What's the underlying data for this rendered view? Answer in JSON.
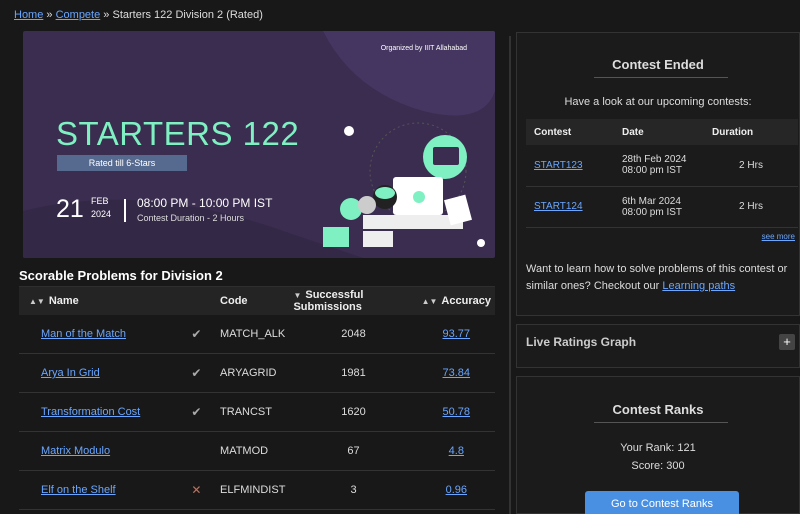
{
  "breadcrumb": {
    "home": "Home",
    "sep1": "»",
    "compete": "Compete",
    "sep2": "»",
    "current": "Starters 122 Division 2 (Rated)"
  },
  "banner": {
    "organizer": "Organized by IIIT Allahabad",
    "title": "STARTERS 122",
    "rated": "Rated till 6-Stars",
    "day": "21",
    "month": "FEB",
    "year": "2024",
    "time": "08:00 PM - 10:00 PM IST",
    "duration": "Contest Duration - 2  Hours",
    "colors": {
      "bg": "#3a2d4f",
      "title": "#7ff0c2",
      "badge": "#566a8f"
    }
  },
  "problems": {
    "title": "Scorable Problems for Division 2",
    "headers": {
      "name": "Name",
      "code": "Code",
      "subs": "Successful Submissions",
      "acc": "Accuracy"
    },
    "rows": [
      {
        "name": "Man of the Match",
        "status": "solved",
        "mark": "✔",
        "code": "MATCH_ALK",
        "subs": "2048",
        "acc": "93.77"
      },
      {
        "name": "Arya In Grid",
        "status": "solved",
        "mark": "✔",
        "code": "ARYAGRID",
        "subs": "1981",
        "acc": "73.84"
      },
      {
        "name": "Transformation Cost",
        "status": "solved",
        "mark": "✔",
        "code": "TRANCST",
        "subs": "1620",
        "acc": "50.78"
      },
      {
        "name": "Matrix Modulo",
        "status": "none",
        "mark": "",
        "code": "MATMOD",
        "subs": "67",
        "acc": "4.8"
      },
      {
        "name": "Elf on the Shelf",
        "status": "wrong",
        "mark": "✕",
        "code": "ELFMINDIST",
        "subs": "3",
        "acc": "0.96"
      }
    ]
  },
  "contest_ended": {
    "title": "Contest Ended",
    "note": "Have a look at our upcoming contests:",
    "headers": {
      "contest": "Contest",
      "date": "Date",
      "duration": "Duration"
    },
    "rows": [
      {
        "contest": "START123",
        "date1": "28th Feb 2024",
        "date2": "08:00 pm IST",
        "duration": "2 Hrs"
      },
      {
        "contest": "START124",
        "date1": "6th Mar 2024",
        "date2": "08:00 pm IST",
        "duration": "2 Hrs"
      }
    ],
    "see_more": "see more",
    "learn_text": "Want to learn how to solve problems of this contest or similar ones? Checkout our ",
    "learn_link": "Learning paths"
  },
  "ratings_graph": {
    "title": "Live Ratings Graph",
    "toggle": "+"
  },
  "ranks": {
    "title": "Contest Ranks",
    "your_rank": "Your Rank: 121",
    "score": "Score: 300",
    "button": "Go to Contest Ranks"
  }
}
